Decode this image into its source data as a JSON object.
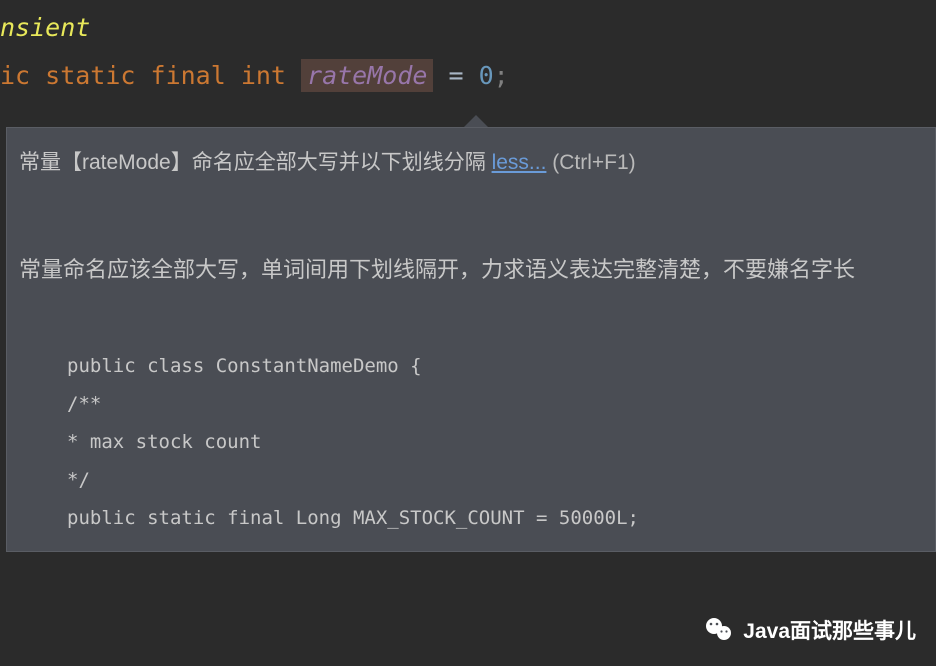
{
  "code": {
    "line1": "nsient",
    "line2_part1": "ic static final int ",
    "line2_var": "rateMode",
    "line2_equals": " = ",
    "line2_value": "0",
    "line2_semi": ";"
  },
  "tooltip": {
    "title_prefix": "常量【rateMode】命名应全部大写并以下划线分隔 ",
    "link_text": "less...",
    "shortcut": " (Ctrl+F1)",
    "description": "常量命名应该全部大写，单词间用下划线隔开，力求语义表达完整清楚，不要嫌名字长",
    "code_line1": "public class ConstantNameDemo {",
    "code_line2": "",
    "code_line3": "/**",
    "code_line4": "* max stock count",
    "code_line5": "*/",
    "code_line6": "public static final Long MAX_STOCK_COUNT = 50000L;"
  },
  "watermark": {
    "text": "Java面试那些事儿"
  }
}
